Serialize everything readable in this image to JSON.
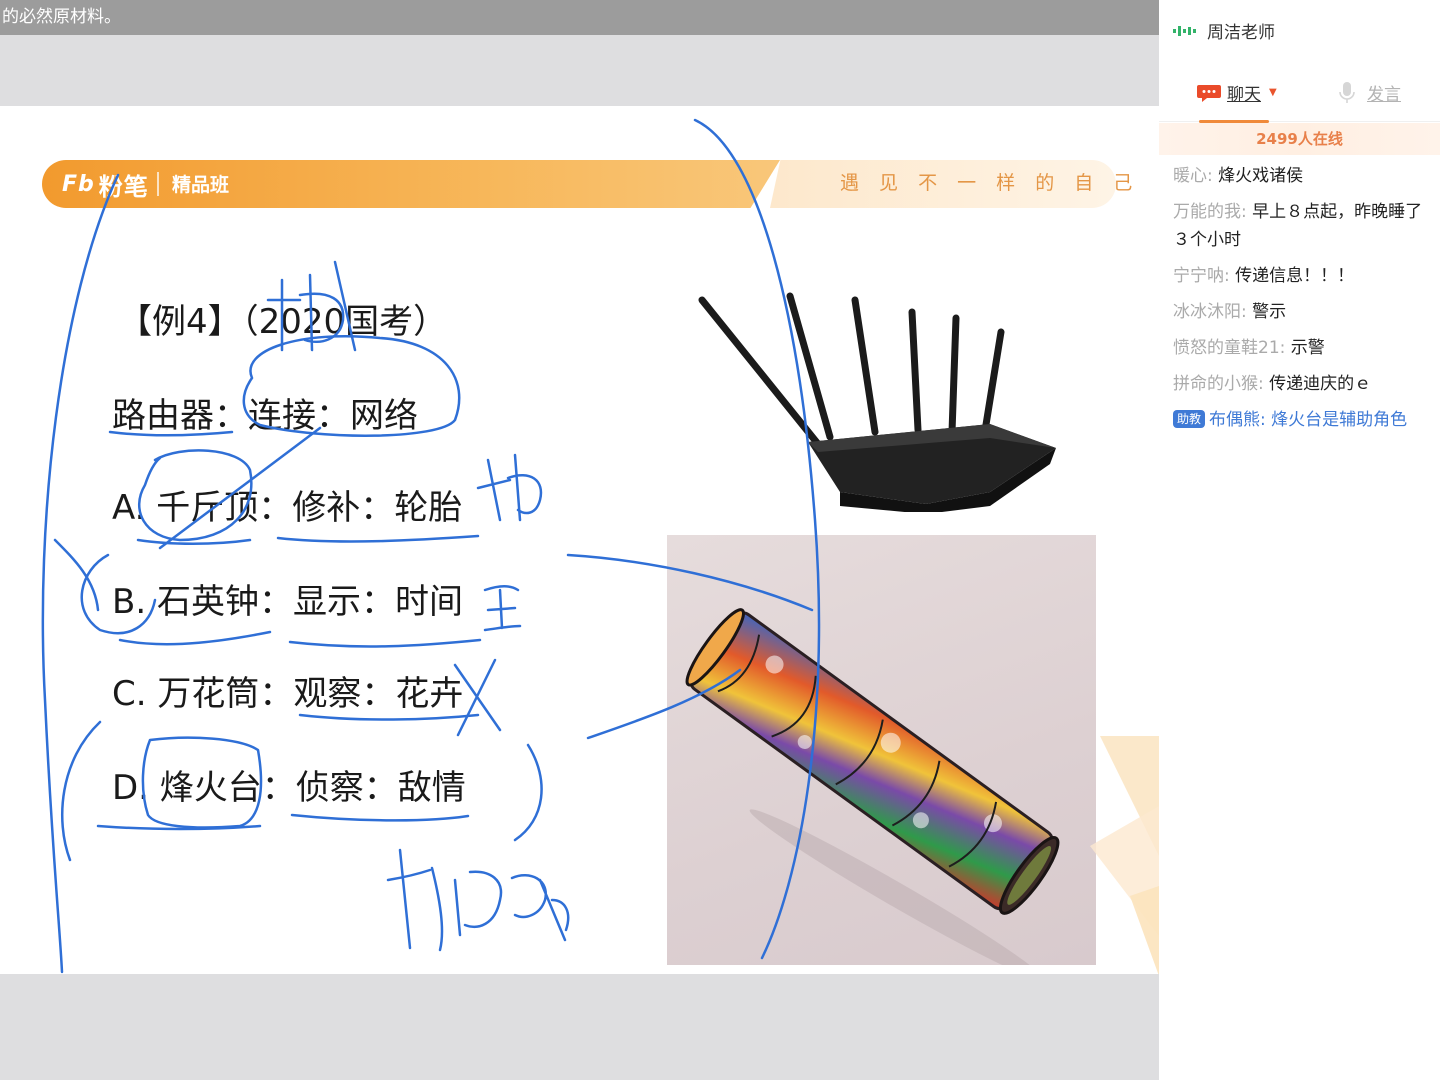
{
  "topbar": {
    "text": "的必然原材料。"
  },
  "slide": {
    "brand": {
      "logo_mark": "Fb",
      "logo_name": "粉笔",
      "class_label": "精品班",
      "slogan": "遇 见 不 一 样 的 自 己"
    },
    "question": {
      "title": "【例4】（2020国考）",
      "stem": "路由器：连接：网络",
      "options": [
        "A. 千斤顶：修补：轮胎",
        "B. 石英钟：显示：时间",
        "C. 万花筒：观察：花卉",
        "D. 烽火台：侦察：敌情"
      ]
    }
  },
  "panel": {
    "teacher_name": "周洁老师",
    "tabs": {
      "chat": "聊天",
      "speak": "发言"
    },
    "online": "2499人在线",
    "messages": [
      {
        "user": "暖心:",
        "text": " 烽火戏诸侯"
      },
      {
        "user": "万能的我:",
        "text": " 早上８点起，昨晚睡了３个小时"
      },
      {
        "user": "宁宁呐:",
        "text": " 传递信息！！！"
      },
      {
        "user": "冰冰沐阳:",
        "text": " 警示"
      },
      {
        "user": "愤怒的童鞋21:",
        "text": " 示警"
      },
      {
        "user": "拼命的小猴:",
        "text": " 传递迪庆的ｅ"
      }
    ],
    "assistant_message": {
      "badge": "助教",
      "user": "布偶熊:",
      "text": " 烽火台是辅助角色"
    }
  },
  "colors": {
    "accent_orange": "#f29a2e",
    "ink_blue": "#2f6fd6",
    "assistant_blue": "#3f7ad6",
    "online_text": "#e8804a"
  }
}
